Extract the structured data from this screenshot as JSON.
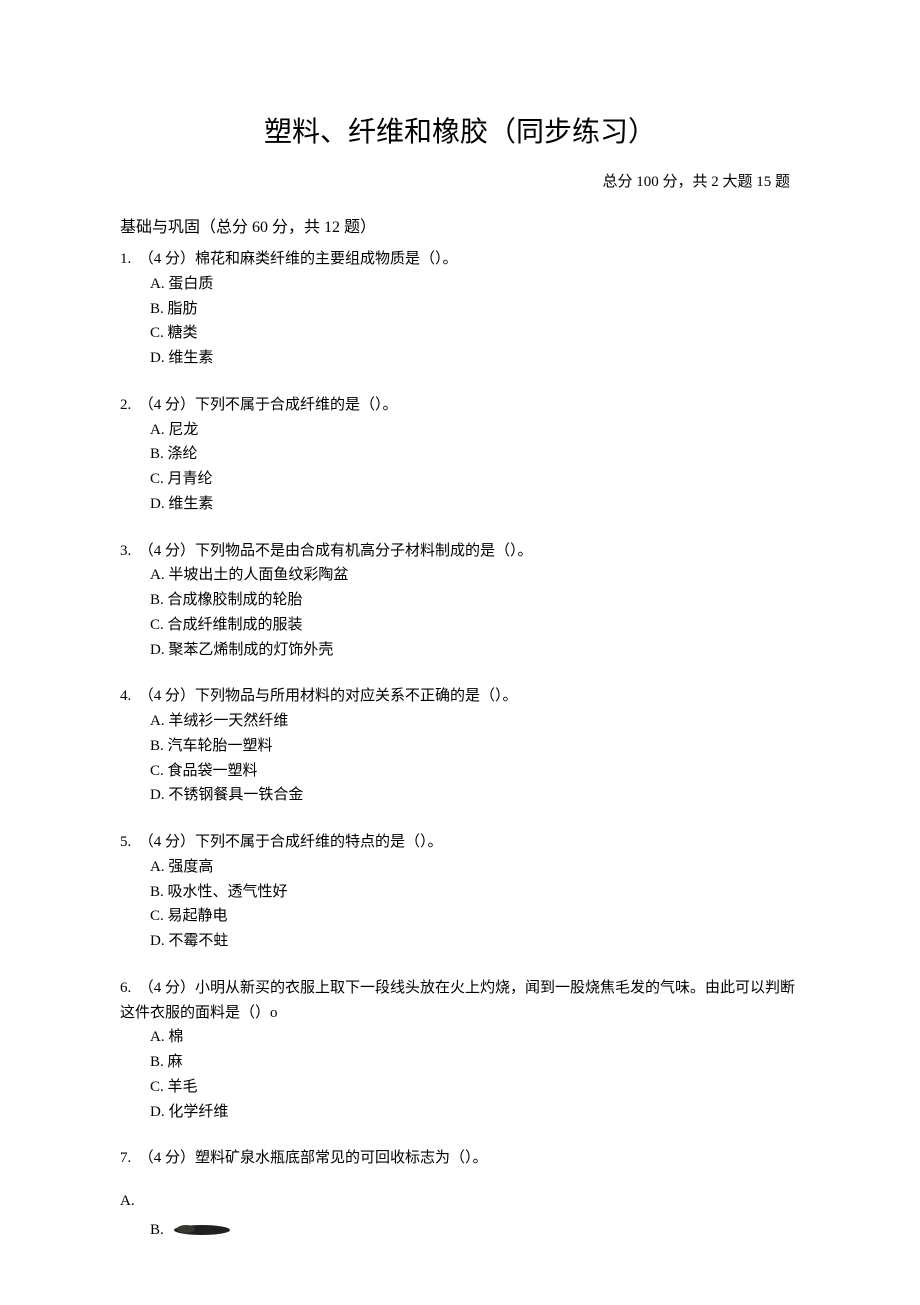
{
  "title": "塑料、纤维和橡胶（同步练习）",
  "subtitle": "总分 100 分，共 2 大题 15 题",
  "section1": {
    "header": "基础与巩固（总分 60 分，共 12 题）"
  },
  "q1": {
    "stem": "1.　（4 分）棉花和麻类纤维的主要组成物质是（）。",
    "a": "A. 蛋白质",
    "b": "B. 脂肪",
    "c": "C. 糖类",
    "d": "D. 维生素"
  },
  "q2": {
    "stem": "2.　（4 分）下列不属于合成纤维的是（）。",
    "a": "A. 尼龙",
    "b": "B. 涤纶",
    "c": "C. 月青纶",
    "d": "D. 维生素"
  },
  "q3": {
    "stem": "3.　（4 分）下列物品不是由合成有机高分子材料制成的是（）。",
    "a": "A. 半坡出土的人面鱼纹彩陶盆",
    "b": "B. 合成橡胶制成的轮胎",
    "c": "C. 合成纤维制成的服装",
    "d": "D. 聚苯乙烯制成的灯饰外壳"
  },
  "q4": {
    "stem": "4.　（4 分）下列物品与所用材料的对应关系不正确的是（）。",
    "a": "A. 羊绒衫一天然纤维",
    "b": "B. 汽车轮胎一塑料",
    "c": "C. 食品袋一塑料",
    "d": "D. 不锈钢餐具一铁合金"
  },
  "q5": {
    "stem": "5.　（4 分）下列不属于合成纤维的特点的是（）。",
    "a": "A. 强度高",
    "b": "B. 吸水性、透气性好",
    "c": "C. 易起静电",
    "d": "D. 不霉不蛀"
  },
  "q6": {
    "stem": "6.　（4 分）小明从新买的衣服上取下一段线头放在火上灼烧，闻到一股烧焦毛发的气味。由此可以判断这件衣服的面料是（）o",
    "a": "A. 棉",
    "b": "B. 麻",
    "c": "C. 羊毛",
    "d": "D. 化学纤维"
  },
  "q7": {
    "stem": "7.　（4 分）塑料矿泉水瓶底部常见的可回收标志为（）。",
    "a": "A.",
    "b": "B."
  }
}
